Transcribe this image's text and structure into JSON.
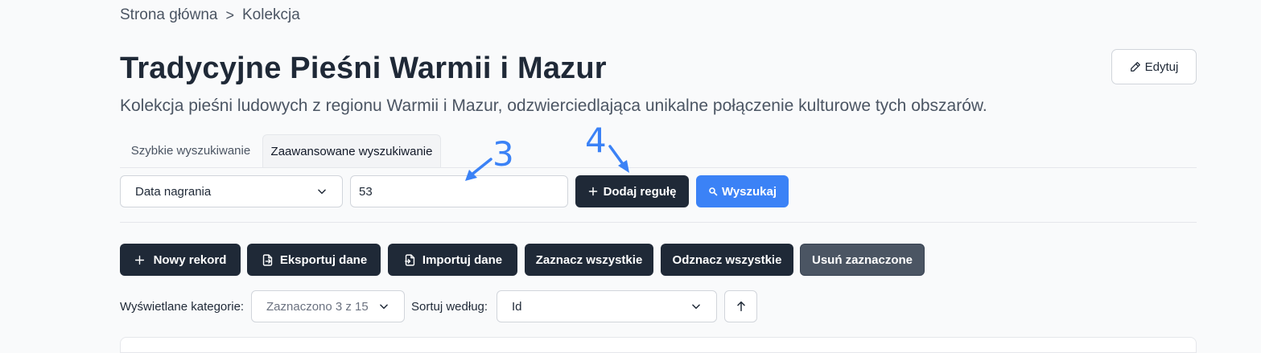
{
  "breadcrumb": {
    "home": "Strona główna",
    "separator": ">",
    "current": "Kolekcja"
  },
  "page": {
    "title": "Tradycyjne Pieśni Warmii i Mazur",
    "description": "Kolekcja pieśni ludowych z regionu Warmii i Mazur, odzwierciedlająca unikalne połączenie kulturowe tych obszarów.",
    "edit_label": "Edytuj"
  },
  "tabs": [
    {
      "label": "Szybkie wyszukiwanie",
      "active": false
    },
    {
      "label": "Zaawansowane wyszukiwanie",
      "active": true
    }
  ],
  "advanced_search": {
    "field_value": "Data nagrania",
    "rule_value": "53",
    "add_rule_label": "Dodaj regułę",
    "search_label": "Wyszukaj"
  },
  "toolbar": {
    "new_record": "Nowy rekord",
    "export": "Eksportuj dane",
    "import": "Importuj dane",
    "select_all": "Zaznacz wszystkie",
    "deselect_all": "Odznacz wszystkie",
    "delete_selected": "Usuń zaznaczone"
  },
  "filters": {
    "categories_label": "Wyświetlane kategorie:",
    "categories_value": "Zaznaczono 3 z 15",
    "sort_label": "Sortuj według:",
    "sort_value": "Id"
  },
  "annotations": {
    "step3": "3",
    "step4": "4"
  },
  "colors": {
    "primary_dark": "#1f2937",
    "accent_blue": "#3b82f6",
    "muted_gray": "#4b5563",
    "background": "#f9fafb"
  }
}
